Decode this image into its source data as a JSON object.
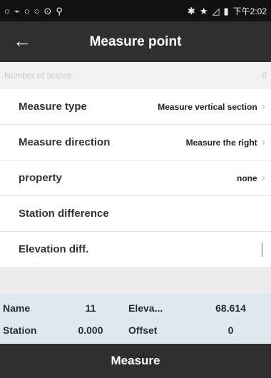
{
  "status_bar": {
    "left_icons": [
      "○",
      "⌁",
      "○",
      "○",
      "⊙",
      "⚲"
    ],
    "right_icons": [
      "✱",
      "★",
      "◿",
      "▮"
    ],
    "time": "下午2:02"
  },
  "header": {
    "title": "Measure point",
    "back_icon": "←"
  },
  "scales": {
    "label": "Number of scales:",
    "value": "0"
  },
  "rows": [
    {
      "label": "Measure type",
      "value": "Measure vertical section",
      "chevron": "›"
    },
    {
      "label": "Measure direction",
      "value": "Measure the right",
      "chevron": "›"
    },
    {
      "label": "property",
      "value": "none",
      "chevron": "›"
    },
    {
      "label": "Station difference",
      "value": ""
    },
    {
      "label": "Elevation diff.",
      "value": ""
    }
  ],
  "info": {
    "row1": {
      "k1": "Name",
      "v1": "11",
      "k2": "Eleva...",
      "v2": "68.614"
    },
    "row2": {
      "k1": "Station",
      "v1": "0.000",
      "k2": "Offset",
      "v2": "0"
    }
  },
  "measure_button": "Measure"
}
